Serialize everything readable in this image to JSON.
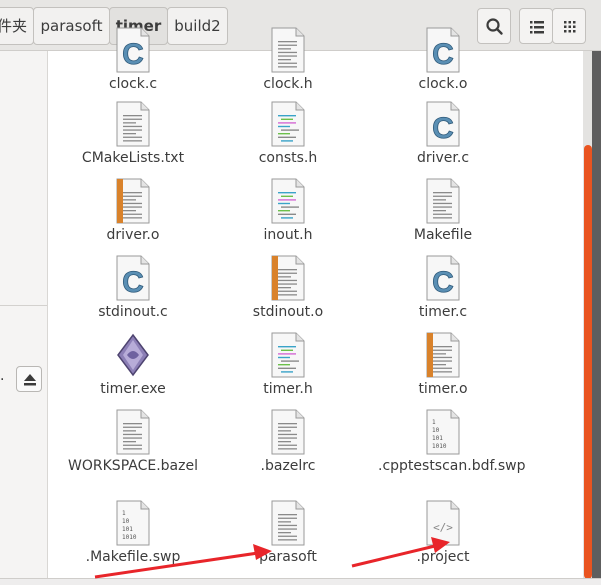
{
  "breadcrumbs": [
    {
      "label": "件夹"
    },
    {
      "label": "parasoft"
    },
    {
      "label": "timer"
    },
    {
      "label": "build2"
    }
  ],
  "sidebar": {
    "fragment": "."
  },
  "files": [
    {
      "name": "clock.c",
      "icon": "c-source-icon"
    },
    {
      "name": "clock.h",
      "icon": "text-doc-icon"
    },
    {
      "name": "clock.o",
      "icon": "c-source-icon"
    },
    {
      "name": "CMakeLists.txt",
      "icon": "text-doc-icon"
    },
    {
      "name": "consts.h",
      "icon": "code-doc-icon"
    },
    {
      "name": "driver.c",
      "icon": "c-source-icon"
    },
    {
      "name": "driver.o",
      "icon": "object-file-icon"
    },
    {
      "name": "inout.h",
      "icon": "code-doc-icon"
    },
    {
      "name": "Makefile",
      "icon": "text-doc-icon"
    },
    {
      "name": "stdinout.c",
      "icon": "c-source-icon"
    },
    {
      "name": "stdinout.o",
      "icon": "object-file-icon"
    },
    {
      "name": "timer.c",
      "icon": "c-source-icon"
    },
    {
      "name": "timer.exe",
      "icon": "executable-icon"
    },
    {
      "name": "timer.h",
      "icon": "code-doc-icon"
    },
    {
      "name": "timer.o",
      "icon": "object-file-icon"
    },
    {
      "name": "WORKSPACE.bazel",
      "icon": "text-doc-icon"
    },
    {
      "name": ".bazelrc",
      "icon": "text-doc-icon"
    },
    {
      "name": ".cpptestscan.bdf.swp",
      "icon": "binary-file-icon"
    },
    {
      "name": ".Makefile.swp",
      "icon": "binary-file-icon"
    },
    {
      "name": "parasoft",
      "icon": "text-doc-icon"
    },
    {
      "name": ".project",
      "icon": "xml-file-icon"
    }
  ],
  "colors": {
    "accent": "#e95420",
    "arrow": "#e8252a",
    "header": "#e7e6e4",
    "sidebar": "#f5f4f3"
  }
}
